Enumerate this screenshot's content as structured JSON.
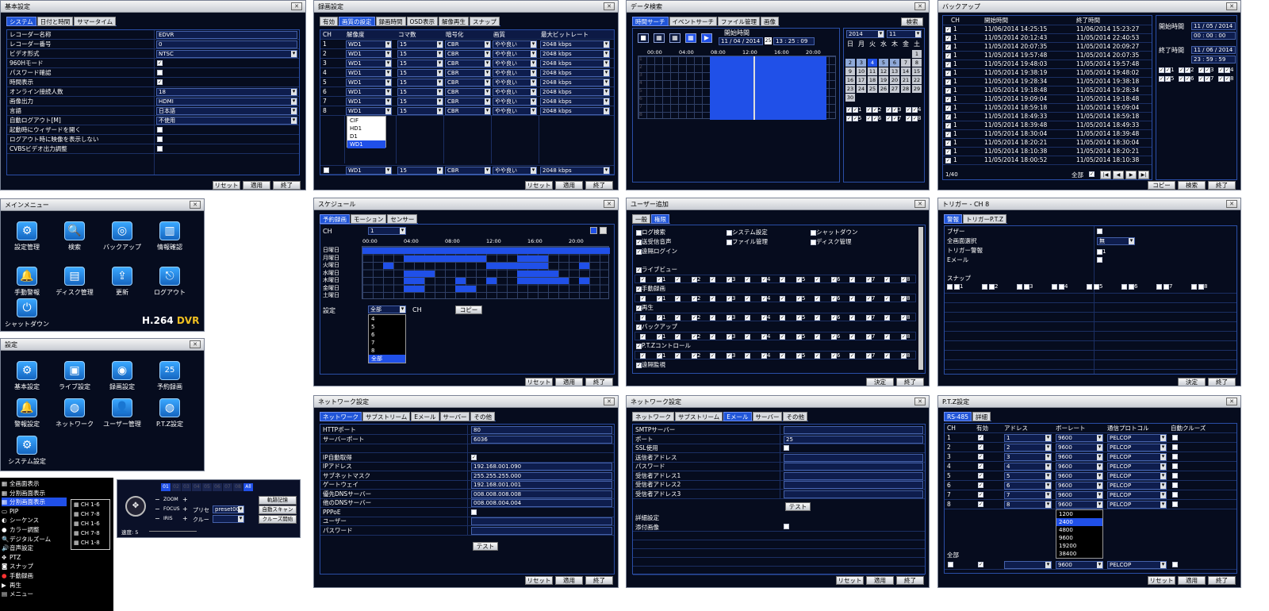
{
  "basic": {
    "title": "基本設定",
    "tabs": [
      "システム",
      "日付と時間",
      "サマータイム"
    ],
    "rows": [
      [
        "レコーダー名称",
        "EDVR"
      ],
      [
        "レコーダー番号",
        "0"
      ],
      [
        "ビデオ形式",
        "NTSC"
      ],
      [
        "960Hモード",
        "check"
      ],
      [
        "パスワード確認",
        "box"
      ],
      [
        "時間表示",
        "check"
      ],
      [
        "オンライン接続人数",
        "18"
      ],
      [
        "画像出力",
        "HDMI"
      ],
      [
        "言語",
        "日本語"
      ],
      [
        "自動ログアウト[M]",
        "不使用"
      ],
      [
        "起動時にウィザードを開く",
        "box"
      ],
      [
        "ログアウト時に映像を表示しない",
        "box"
      ],
      [
        "CVBSビデオ出力調整",
        "box"
      ]
    ],
    "buttons": [
      "リセット",
      "適用",
      "終了"
    ]
  },
  "rec": {
    "title": "録画設定",
    "tabs": [
      "有効",
      "画質の設定",
      "録画時間",
      "OSD表示",
      "解像再生",
      "スナップ"
    ],
    "headers": [
      "CH",
      "解像度",
      "コマ数",
      "暗号化",
      "画質",
      "最大ビットレート"
    ],
    "row": [
      "WD1",
      "15",
      "CBR",
      "やや良い",
      "2048 kbps"
    ],
    "options": [
      "CIF",
      "HD1",
      "D1",
      "WD1"
    ],
    "buttons": [
      "リセット",
      "適用",
      "終了"
    ]
  },
  "search": {
    "title": "データ検索",
    "tabs": [
      "時間サーチ",
      "イベントサーチ",
      "ファイル管理",
      "画像"
    ],
    "search_btn": "検索",
    "start_label": "開始時間",
    "date": "11 / 04 / 2014",
    "time": "13 : 25 : 09",
    "hours": [
      "00:00",
      "04:00",
      "08:00",
      "12:00",
      "16:00",
      "20:00"
    ],
    "year": "2014",
    "month": "11",
    "weekdays": [
      "日",
      "月",
      "火",
      "水",
      "木",
      "金",
      "土"
    ],
    "days": [
      "1",
      "2",
      "3",
      "4",
      "5",
      "6",
      "7",
      "8",
      "9",
      "10",
      "11",
      "12",
      "13",
      "14",
      "15",
      "16",
      "17",
      "18",
      "19",
      "20",
      "21",
      "22",
      "23",
      "24",
      "25",
      "26",
      "27",
      "28",
      "29",
      "30"
    ],
    "chans": [
      "1",
      "2",
      "3",
      "4",
      "5",
      "6",
      "7",
      "8"
    ]
  },
  "backup": {
    "title": "バックアップ",
    "headers": [
      "CH",
      "開始時間",
      "終了時間"
    ],
    "rows": [
      [
        "11/06/2014 14:25:15",
        "11/06/2014 15:23:27"
      ],
      [
        "11/05/2014 20:12:43",
        "11/05/2014 22:40:53"
      ],
      [
        "11/05/2014 20:07:35",
        "11/05/2014 20:09:27"
      ],
      [
        "11/05/2014 19:57:48",
        "11/05/2014 20:07:35"
      ],
      [
        "11/05/2014 19:48:03",
        "11/05/2014 19:57:48"
      ],
      [
        "11/05/2014 19:38:19",
        "11/05/2014 19:48:02"
      ],
      [
        "11/05/2014 19:28:34",
        "11/05/2014 19:38:18"
      ],
      [
        "11/05/2014 19:18:48",
        "11/05/2014 19:28:34"
      ],
      [
        "11/05/2014 19:09:04",
        "11/05/2014 19:18:48"
      ],
      [
        "11/05/2014 18:59:18",
        "11/05/2014 19:09:04"
      ],
      [
        "11/05/2014 18:49:33",
        "11/05/2014 18:59:18"
      ],
      [
        "11/05/2014 18:39:48",
        "11/05/2014 18:49:33"
      ],
      [
        "11/05/2014 18:30:04",
        "11/05/2014 18:39:48"
      ],
      [
        "11/05/2014 18:20:21",
        "11/05/2014 18:30:04"
      ],
      [
        "11/05/2014 18:10:38",
        "11/05/2014 18:20:21"
      ],
      [
        "11/05/2014 18:00:52",
        "11/05/2014 18:10:38"
      ]
    ],
    "start_label": "開始時間",
    "start_date": "11 / 05 / 2014",
    "start_time": "00 : 00 : 00",
    "end_label": "終了時間",
    "end_date": "11 / 06 / 2014",
    "end_time": "23 : 59 : 59",
    "page": "1/40",
    "all": "全部",
    "buttons": [
      "コピー",
      "検索",
      "終了"
    ]
  },
  "mainmenu": {
    "title": "メインメニュー",
    "items": [
      [
        "設定管理",
        "⚙"
      ],
      [
        "検索",
        "🔍"
      ],
      [
        "バックアップ",
        "◎"
      ],
      [
        "情報確認",
        "▥"
      ],
      [
        "手動警報",
        "🔔"
      ],
      [
        "ディスク管理",
        "▤"
      ],
      [
        "更新",
        "⇪"
      ],
      [
        "ログアウト",
        "⎋"
      ],
      [
        "シャットダウン",
        "⏻"
      ]
    ],
    "logo1": "H.264",
    "logo2": "DVR"
  },
  "setup": {
    "title": "設定",
    "items": [
      [
        "基本設定",
        "⚙"
      ],
      [
        "ライブ設定",
        "▣"
      ],
      [
        "録画設定",
        "◉"
      ],
      [
        "予約録画",
        "25"
      ],
      [
        "警報設定",
        "🔔"
      ],
      [
        "ネットワーク",
        "◍"
      ],
      [
        "ユーザー管理",
        "👤"
      ],
      [
        "P.T.Z設定",
        "◍"
      ],
      [
        "システム設定",
        "⚙"
      ]
    ]
  },
  "schedule": {
    "title": "スケジュール",
    "tabs": [
      "予約録画",
      "モーション",
      "センサー"
    ],
    "ch_label": "CH",
    "ch": "1",
    "hours": [
      "00:00",
      "04:00",
      "08:00",
      "12:00",
      "16:00",
      "20:00"
    ],
    "days": [
      "日曜日",
      "月曜日",
      "火曜日",
      "水曜日",
      "木曜日",
      "金曜日",
      "土曜日"
    ],
    "setting_label": "設定",
    "setting_val": "全部",
    "ch2": "CH",
    "copy": "コピー",
    "list": [
      "4",
      "5",
      "6",
      "7",
      "8",
      "全部"
    ],
    "buttons": [
      "リセット",
      "適用",
      "終了"
    ]
  },
  "useradd": {
    "title": "ユーザー追加",
    "tabs": [
      "一般",
      "権限"
    ],
    "perms": [
      [
        "ログ検索",
        "システム設定",
        "シャットダウン"
      ],
      [
        "送受信音声",
        "ファイル管理",
        "ディスク管理"
      ],
      [
        "遠隔ログイン",
        "",
        ""
      ]
    ],
    "sections": [
      "ライブビュー",
      "手動録画",
      "再生",
      "バックアップ",
      "P.T.Zコントロール",
      "遠隔監視"
    ],
    "chans": [
      "1",
      "2",
      "3",
      "4",
      "5",
      "6",
      "7",
      "8"
    ],
    "buttons": [
      "決定",
      "終了"
    ]
  },
  "trigger": {
    "title": "トリガー - CH 8",
    "tabs": [
      "警報",
      "トリガーP.T.Z"
    ],
    "rows": [
      [
        "ブザー",
        ""
      ],
      [
        "全画面選択",
        "無"
      ],
      [
        "トリガー警報",
        "1"
      ],
      [
        "Eメール",
        ""
      ]
    ],
    "snap": "スナップ",
    "chans": [
      "1",
      "2",
      "3",
      "4",
      "5",
      "6",
      "7",
      "8"
    ],
    "buttons": [
      "決定",
      "終了"
    ]
  },
  "net1": {
    "title": "ネットワーク設定",
    "tabs": [
      "ネットワーク",
      "サブストリーム",
      "Eメール",
      "サーバー",
      "その他"
    ],
    "rows": [
      [
        "HTTPポート",
        "80"
      ],
      [
        "サーバーポート",
        "6036"
      ],
      [
        "",
        ""
      ],
      [
        "IP自動取得",
        "check"
      ],
      [
        "IPアドレス",
        "192.168.001.090"
      ],
      [
        "サブネットマスク",
        "255.255.255.000"
      ],
      [
        "ゲートウェイ",
        "192.168.001.001"
      ],
      [
        "優先DNSサーバー",
        "008.008.008.008"
      ],
      [
        "他のDNSサーバー",
        "008.008.004.004"
      ],
      [
        "PPPoE",
        "box"
      ],
      [
        "ユーザー",
        ""
      ],
      [
        "パスワード",
        ""
      ]
    ],
    "test": "テスト",
    "buttons": [
      "リセット",
      "適用",
      "終了"
    ]
  },
  "net2": {
    "title": "ネットワーク設定",
    "tabs": [
      "ネットワーク",
      "サブストリーム",
      "Eメール",
      "サーバー",
      "その他"
    ],
    "rows": [
      [
        "SMTPサーバー",
        ""
      ],
      [
        "ポート",
        "25"
      ],
      [
        "SSL使用",
        "box"
      ],
      [
        "送信者アドレス",
        ""
      ],
      [
        "パスワード",
        ""
      ],
      [
        "受信者アドレス1",
        ""
      ],
      [
        "受信者アドレス2",
        ""
      ],
      [
        "受信者アドレス3",
        ""
      ]
    ],
    "test": "テスト",
    "detail": "詳細設定",
    "attach": "添付画像",
    "buttons": [
      "リセット",
      "適用",
      "終了"
    ]
  },
  "ptz": {
    "title": "P.T.Z設定",
    "tabs": [
      "RS-485",
      "詳細"
    ],
    "headers": [
      "CH",
      "有効",
      "アドレス",
      "ボーレート",
      "通信プロトコル",
      "自動クルーズ"
    ],
    "rate": "9600",
    "proto": "PELCOP",
    "rates": [
      "1200",
      "2400",
      "4800",
      "9600",
      "19200",
      "38400"
    ],
    "all": "全部",
    "buttons": [
      "リセット",
      "適用",
      "終了"
    ]
  },
  "ctx": {
    "items": [
      "全画面表示",
      "分割画面表示",
      "分割画面表示",
      "PIP",
      "シーケンス",
      "カラー調整",
      "デジタルズーム",
      "音声設定",
      "PTZ",
      "スナップ",
      "手動録画",
      "再生",
      "メニュー"
    ],
    "sub": [
      "CH 1-6",
      "CH 7-8",
      "CH 1-6",
      "CH 7-8",
      "CH 1-8"
    ]
  },
  "ptzctl": {
    "chans": [
      "01",
      "02",
      "03",
      "04",
      "05",
      "06",
      "07",
      "08",
      "All"
    ],
    "zoom": "ZOOM",
    "focus": "FOCUS",
    "iris": "IRIS",
    "preset": "プリセ",
    "preset_val": "preset001",
    "cruise": "クルー",
    "b1": "軌跡記憶",
    "b2": "自動スキャン",
    "b3": "クルーズ開始",
    "speed": "速度: 5"
  }
}
